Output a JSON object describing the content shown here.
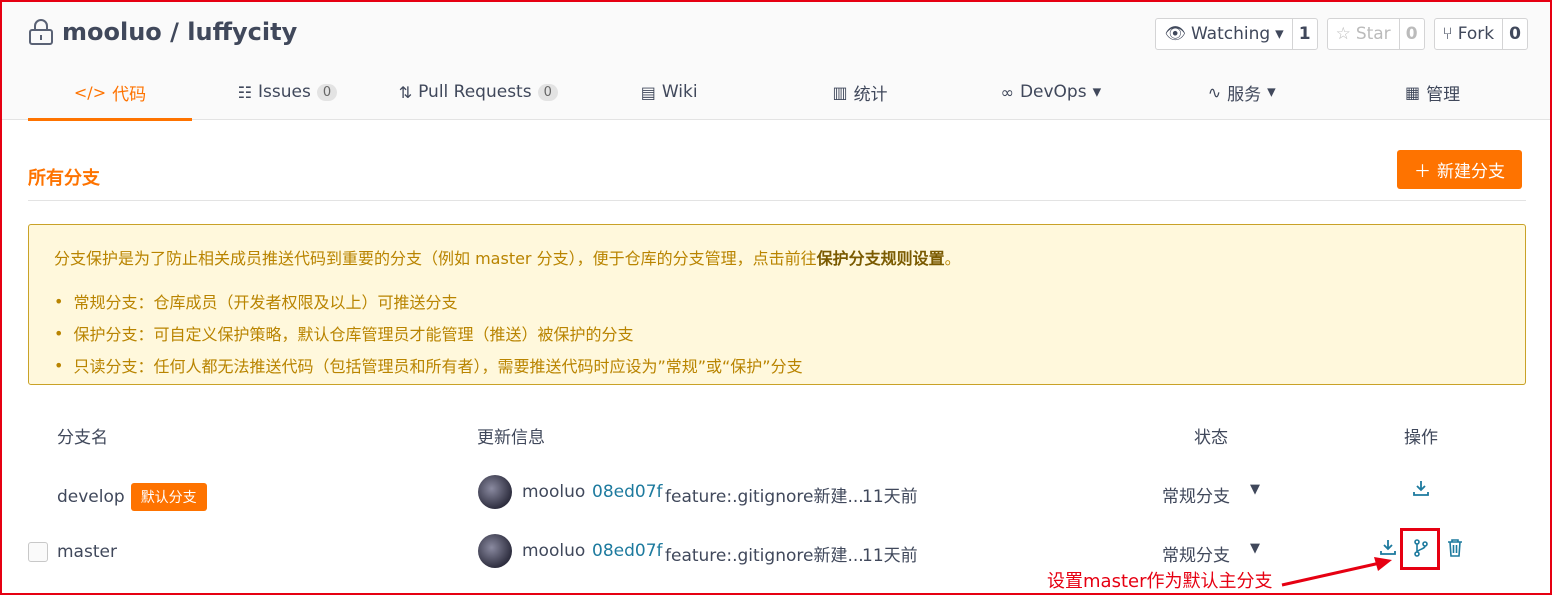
{
  "repo": {
    "path": "mooluo / luffycity",
    "watch": {
      "label": "Watching",
      "count": "1"
    },
    "star": {
      "label": "Star",
      "count": "0"
    },
    "fork": {
      "label": "Fork",
      "count": "0"
    }
  },
  "tabs": [
    {
      "label": "代码",
      "icon": "code-icon"
    },
    {
      "label": "Issues",
      "badge": "0",
      "icon": "issues-icon"
    },
    {
      "label": "Pull Requests",
      "badge": "0",
      "icon": "pull-request-icon"
    },
    {
      "label": "Wiki",
      "icon": "book-icon"
    },
    {
      "label": "统计",
      "icon": "chart-icon"
    },
    {
      "label": "DevOps",
      "icon": "infinity-icon"
    },
    {
      "label": "服务",
      "icon": "pulse-icon"
    },
    {
      "label": "管理",
      "icon": "document-icon"
    }
  ],
  "section": {
    "title": "所有分支",
    "new_branch": "新建分支"
  },
  "notice": {
    "lead": "分支保护是为了防止相关成员推送代码到重要的分支（例如 master 分支），便于仓库的分支管理，点击前往",
    "lead_link": "保护分支规则设置",
    "lead_end": "。",
    "items": [
      "常规分支：仓库成员（开发者权限及以上）可推送分支",
      "保护分支：可自定义保护策略，默认仓库管理员才能管理（推送）被保护的分支",
      "只读分支：任何人都无法推送代码（包括管理员和所有者），需要推送代码时应设为”常规”或“保护”分支"
    ]
  },
  "table": {
    "headers": {
      "name": "分支名",
      "update": "更新信息",
      "status": "状态",
      "ops": "操作"
    },
    "rows": [
      {
        "name": "develop",
        "tag": "默认分支",
        "author": "mooluo",
        "sha": "08ed07f",
        "message": "feature:.gitignore新建...",
        "time": "11天前",
        "status": "常规分支"
      },
      {
        "name": "master",
        "author": "mooluo",
        "sha": "08ed07f",
        "message": "feature:.gitignore新建...",
        "time": "11天前",
        "status": "常规分支"
      }
    ]
  },
  "annotation": "设置master作为默认主分支",
  "colors": {
    "accent": "#fe7300",
    "link": "#1d7a9e",
    "annotation": "#e60012"
  }
}
